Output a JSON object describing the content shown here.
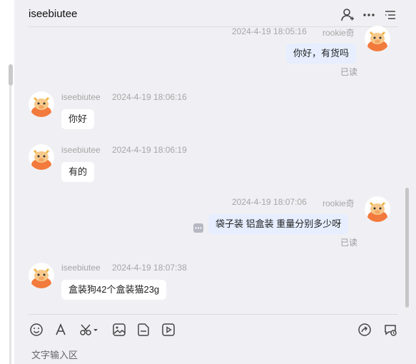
{
  "chat": {
    "title": "iseebiutee",
    "input_placeholder": "文字输入区"
  },
  "messages": [
    {
      "direction": "out",
      "time": "2024-4-19 18:05:16",
      "sender": "rookie奇",
      "text": "你好，有货吗",
      "status": "已读"
    },
    {
      "direction": "in",
      "sender": "iseebiutee",
      "time": "2024-4-19 18:06:16",
      "text": "你好"
    },
    {
      "direction": "in",
      "sender": "iseebiutee",
      "time": "2024-4-19 18:06:19",
      "text": "有的"
    },
    {
      "direction": "out",
      "time": "2024-4-19 18:07:06",
      "sender": "rookie奇",
      "text": "袋子装  铝盒装  重量分别多少呀",
      "status": "已读"
    },
    {
      "direction": "in",
      "sender": "iseebiutee",
      "time": "2024-4-19 18:07:38",
      "text": "盒装狗42个盒装猫23g"
    }
  ],
  "header_icons": [
    "add-user-icon",
    "more-icon",
    "menu-icon"
  ],
  "toolbar_icons": [
    "emoji-icon",
    "font-icon",
    "scissors-icon",
    "image-icon",
    "file-icon",
    "video-icon",
    "share-icon",
    "history-icon"
  ],
  "colors": {
    "background": "#f0f0f4",
    "outgoing_bubble": "#e6eeff",
    "incoming_bubble": "#ffffff",
    "avatar_orange": "#f27a3c"
  }
}
